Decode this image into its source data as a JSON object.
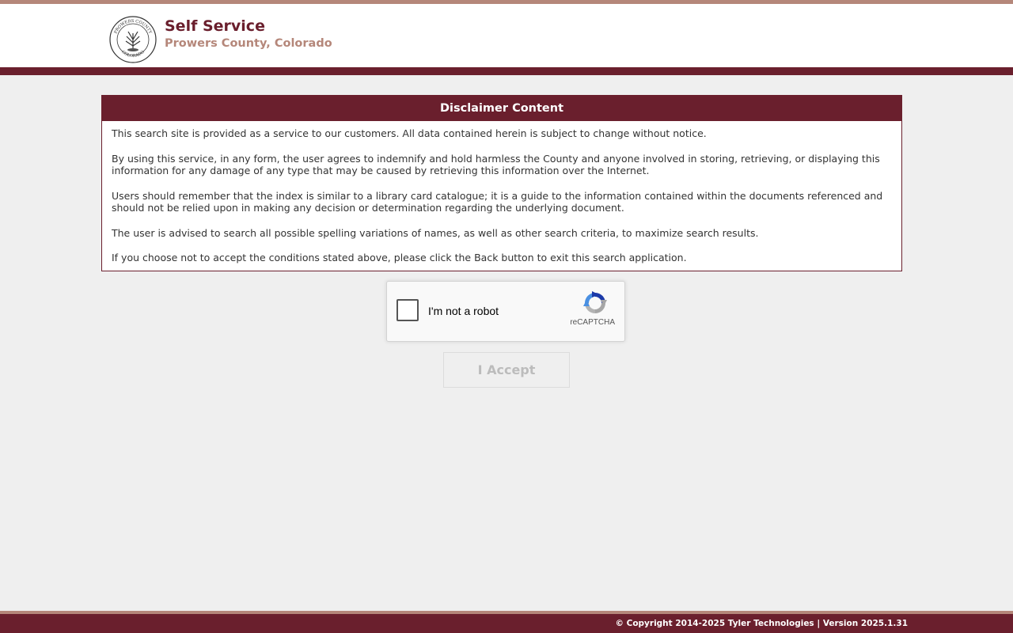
{
  "header": {
    "title": "Self Service",
    "subtitle": "Prowers County, Colorado",
    "seal": {
      "icon": "county-seal-icon",
      "ring_text_top": "PROWERS COUNTY",
      "ring_text_bottom": "COLORADO"
    }
  },
  "disclaimer": {
    "heading": "Disclaimer Content",
    "paragraphs": [
      "This search site is provided as a service to our customers. All data contained herein is subject to change without notice.",
      "By using this service, in any form, the user agrees to indemnify and hold harmless the County and anyone involved in storing, retrieving, or displaying this information for any damage of any type that may be caused by retrieving this information over the Internet.",
      "Users should remember that the index is similar to a library card catalogue; it is a guide to the information contained within the documents referenced and should not be relied upon in making any decision or determination regarding the underlying document.",
      "The user is advised to search all possible spelling variations of names, as well as other search criteria, to maximize search results.",
      "If you choose not to accept the conditions stated above, please click the Back button to exit this search application."
    ]
  },
  "captcha": {
    "label": "I'm not a robot",
    "brand": "reCAPTCHA",
    "checked": false,
    "icon": "recaptcha-logo-icon"
  },
  "accept_button": {
    "label": "I Accept",
    "enabled": false
  },
  "footer": {
    "text": "© Copyright 2014-2025 Tyler Technologies | Version 2025.1.31"
  },
  "colors": {
    "brand": "#6a1f2d",
    "accent": "#b5877a",
    "background": "#efefef"
  }
}
